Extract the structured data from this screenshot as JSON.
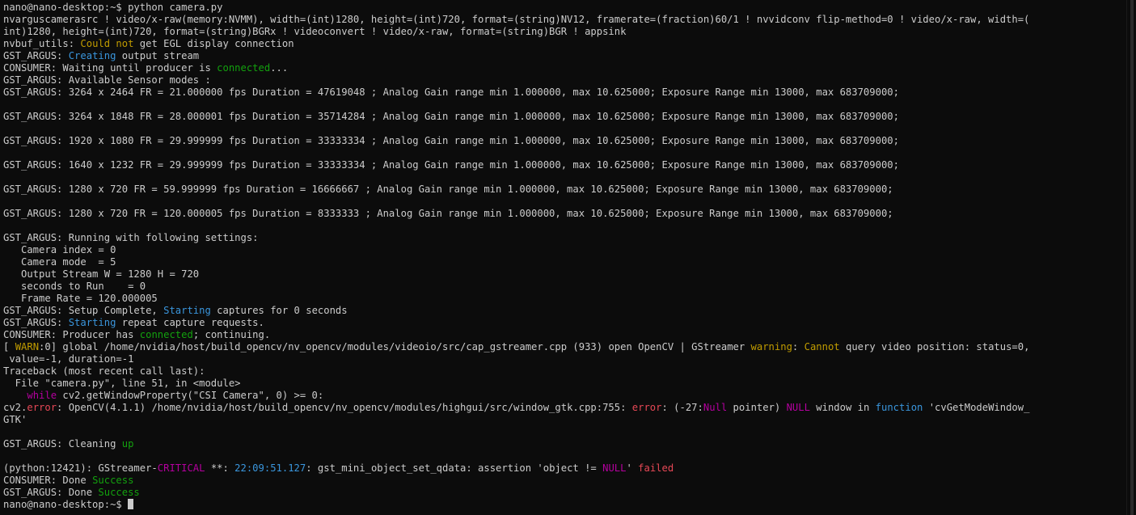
{
  "terminal": {
    "lines": [
      [
        {
          "t": "nano@nano-desktop:~$ python camera.py",
          "c": ""
        }
      ],
      [
        {
          "t": "nvarguscamerasrc ! video/x-raw(memory:NVMM), width=(int)1280, height=(int)720, format=(string)NV12, framerate=(fraction)60/1 ! nvvidconv flip-method=0 ! video/x-raw, width=(",
          "c": ""
        }
      ],
      [
        {
          "t": "int)1280, height=(int)720, format=(string)BGRx ! videoconvert ! video/x-raw, format=(string)BGR ! appsink",
          "c": ""
        }
      ],
      [
        {
          "t": "nvbuf_utils: ",
          "c": ""
        },
        {
          "t": "Could not",
          "c": "yellow"
        },
        {
          "t": " get EGL display connection",
          "c": ""
        }
      ],
      [
        {
          "t": "GST_ARGUS: ",
          "c": ""
        },
        {
          "t": "Creating",
          "c": "cyan"
        },
        {
          "t": " output stream",
          "c": ""
        }
      ],
      [
        {
          "t": "CONSUMER: Waiting until producer is ",
          "c": ""
        },
        {
          "t": "connected",
          "c": "green"
        },
        {
          "t": "...",
          "c": ""
        }
      ],
      [
        {
          "t": "GST_ARGUS: Available Sensor modes :",
          "c": ""
        }
      ],
      [
        {
          "t": "GST_ARGUS: 3264 x 2464 FR = 21.000000 fps Duration = 47619048 ; Analog Gain range min 1.000000, max 10.625000; Exposure Range min 13000, max 683709000;",
          "c": ""
        }
      ],
      [
        {
          "t": "",
          "c": ""
        }
      ],
      [
        {
          "t": "GST_ARGUS: 3264 x 1848 FR = 28.000001 fps Duration = 35714284 ; Analog Gain range min 1.000000, max 10.625000; Exposure Range min 13000, max 683709000;",
          "c": ""
        }
      ],
      [
        {
          "t": "",
          "c": ""
        }
      ],
      [
        {
          "t": "GST_ARGUS: 1920 x 1080 FR = 29.999999 fps Duration = 33333334 ; Analog Gain range min 1.000000, max 10.625000; Exposure Range min 13000, max 683709000;",
          "c": ""
        }
      ],
      [
        {
          "t": "",
          "c": ""
        }
      ],
      [
        {
          "t": "GST_ARGUS: 1640 x 1232 FR = 29.999999 fps Duration = 33333334 ; Analog Gain range min 1.000000, max 10.625000; Exposure Range min 13000, max 683709000;",
          "c": ""
        }
      ],
      [
        {
          "t": "",
          "c": ""
        }
      ],
      [
        {
          "t": "GST_ARGUS: 1280 x 720 FR = 59.999999 fps Duration = 16666667 ; Analog Gain range min 1.000000, max 10.625000; Exposure Range min 13000, max 683709000;",
          "c": ""
        }
      ],
      [
        {
          "t": "",
          "c": ""
        }
      ],
      [
        {
          "t": "GST_ARGUS: 1280 x 720 FR = 120.000005 fps Duration = 8333333 ; Analog Gain range min 1.000000, max 10.625000; Exposure Range min 13000, max 683709000;",
          "c": ""
        }
      ],
      [
        {
          "t": "",
          "c": ""
        }
      ],
      [
        {
          "t": "GST_ARGUS: Running with following settings:",
          "c": ""
        }
      ],
      [
        {
          "t": "   Camera index = 0",
          "c": ""
        }
      ],
      [
        {
          "t": "   Camera mode  = 5",
          "c": ""
        }
      ],
      [
        {
          "t": "   Output Stream W = 1280 H = 720",
          "c": ""
        }
      ],
      [
        {
          "t": "   seconds to Run    = 0",
          "c": ""
        }
      ],
      [
        {
          "t": "   Frame Rate = 120.000005",
          "c": ""
        }
      ],
      [
        {
          "t": "GST_ARGUS: Setup Complete, ",
          "c": ""
        },
        {
          "t": "Starting",
          "c": "cyan"
        },
        {
          "t": " captures for 0 seconds",
          "c": ""
        }
      ],
      [
        {
          "t": "GST_ARGUS: ",
          "c": ""
        },
        {
          "t": "Starting",
          "c": "cyan"
        },
        {
          "t": " repeat capture requests.",
          "c": ""
        }
      ],
      [
        {
          "t": "CONSUMER: Producer has ",
          "c": ""
        },
        {
          "t": "connected",
          "c": "green"
        },
        {
          "t": "; continuing.",
          "c": ""
        }
      ],
      [
        {
          "t": "[ ",
          "c": ""
        },
        {
          "t": "WARN",
          "c": "yellow"
        },
        {
          "t": ":0] global /home/nvidia/host/build_opencv/nv_opencv/modules/videoio/src/cap_gstreamer.cpp (933) open OpenCV | GStreamer ",
          "c": ""
        },
        {
          "t": "warning",
          "c": "yellow"
        },
        {
          "t": ": ",
          "c": ""
        },
        {
          "t": "Cannot",
          "c": "yellow"
        },
        {
          "t": " query video position: status=0,",
          "c": ""
        }
      ],
      [
        {
          "t": " value=-1, duration=-1",
          "c": ""
        }
      ],
      [
        {
          "t": "Traceback (most recent call last):",
          "c": ""
        }
      ],
      [
        {
          "t": "  File \"camera.py\", line 51, in <module>",
          "c": ""
        }
      ],
      [
        {
          "t": "    ",
          "c": ""
        },
        {
          "t": "while",
          "c": "magenta"
        },
        {
          "t": " cv2.getWindowProperty(\"CSI Camera\", 0) >= 0:",
          "c": ""
        }
      ],
      [
        {
          "t": "cv2.",
          "c": ""
        },
        {
          "t": "error",
          "c": "red"
        },
        {
          "t": ": OpenCV(4.1.1) /home/nvidia/host/build_opencv/nv_opencv/modules/highgui/src/window_gtk.cpp:755: ",
          "c": ""
        },
        {
          "t": "error",
          "c": "red"
        },
        {
          "t": ": (-27:",
          "c": ""
        },
        {
          "t": "Null",
          "c": "magenta"
        },
        {
          "t": " pointer) ",
          "c": ""
        },
        {
          "t": "NULL",
          "c": "magenta"
        },
        {
          "t": " window in ",
          "c": ""
        },
        {
          "t": "function",
          "c": "cyan"
        },
        {
          "t": " 'cvGetModeWindow_",
          "c": ""
        }
      ],
      [
        {
          "t": "GTK'",
          "c": ""
        }
      ],
      [
        {
          "t": "",
          "c": ""
        }
      ],
      [
        {
          "t": "GST_ARGUS: Cleaning ",
          "c": ""
        },
        {
          "t": "up",
          "c": "green"
        }
      ],
      [
        {
          "t": "",
          "c": ""
        }
      ],
      [
        {
          "t": "(python:12421): GStreamer-",
          "c": ""
        },
        {
          "t": "CRITICAL",
          "c": "magenta"
        },
        {
          "t": " **: ",
          "c": ""
        },
        {
          "t": "22:09:51.127",
          "c": "cyan"
        },
        {
          "t": ": gst_mini_object_set_qdata: assertion 'object != ",
          "c": ""
        },
        {
          "t": "NULL",
          "c": "magenta"
        },
        {
          "t": "' ",
          "c": ""
        },
        {
          "t": "failed",
          "c": "red"
        }
      ],
      [
        {
          "t": "CONSUMER: Done ",
          "c": ""
        },
        {
          "t": "Success",
          "c": "green"
        }
      ],
      [
        {
          "t": "GST_ARGUS: Done ",
          "c": ""
        },
        {
          "t": "Success",
          "c": "green"
        }
      ],
      [
        {
          "t": "nano@nano-desktop:~$ ",
          "c": ""
        }
      ]
    ]
  },
  "colors": {
    "background": "#0c0c0c",
    "foreground": "#cccccc",
    "cyan": "#3a96dd",
    "green": "#13a10e",
    "yellow": "#c19c00",
    "red": "#e74856",
    "magenta": "#b4009e"
  }
}
